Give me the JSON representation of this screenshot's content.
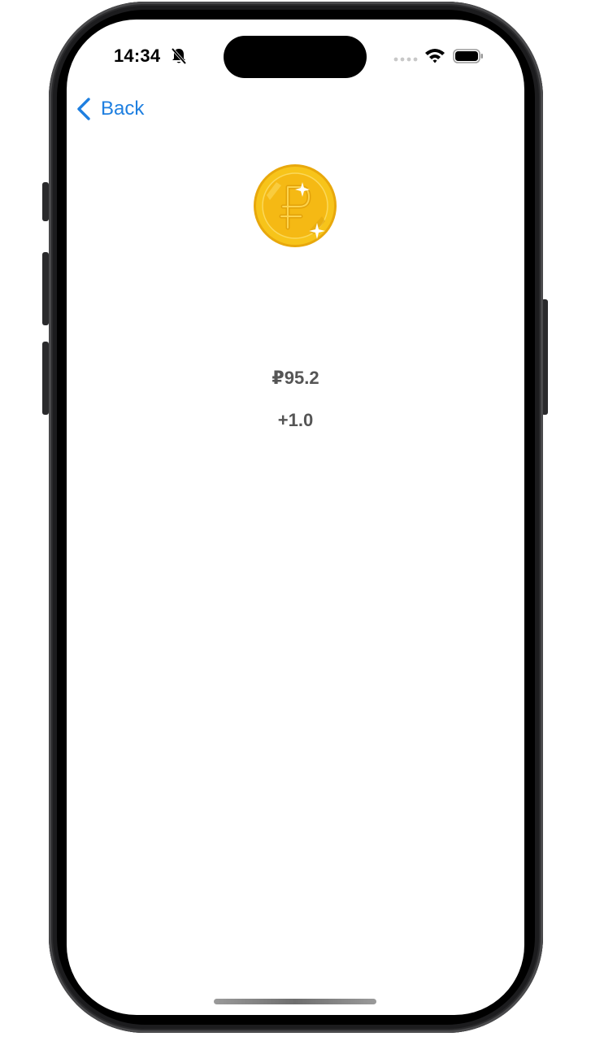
{
  "status_bar": {
    "time": "14:34",
    "icons": [
      "bell-off-icon",
      "signal-dots-icon",
      "wifi-icon",
      "battery-icon"
    ]
  },
  "nav": {
    "back_label": "Back",
    "back_icon": "chevron-left-icon"
  },
  "coin": {
    "icon": "ruble-coin-icon"
  },
  "quote": {
    "price": "₽95.2",
    "change": "+1.0"
  },
  "colors": {
    "accent": "#1e7fe0",
    "value_text": "#555555",
    "coin_gold": "#f5c518",
    "coin_dark": "#e3a810"
  }
}
